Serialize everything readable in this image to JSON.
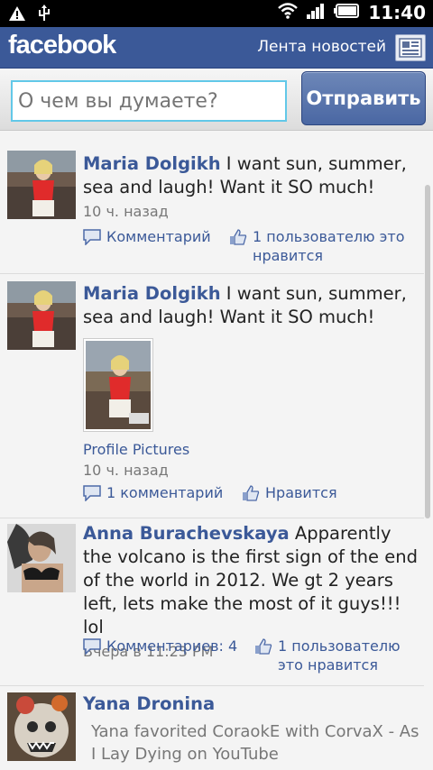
{
  "status_bar": {
    "time": "11:40"
  },
  "header": {
    "logo": "facebook",
    "feed_label": "Лента новостей"
  },
  "composer": {
    "placeholder": "О чем вы думаете?",
    "send_label": "Отправить"
  },
  "stories": [
    {
      "author": "Maria Dolgikh",
      "text": " I want sun, summer, sea and laugh! Want it SO  much!",
      "time": "10 ч. назад",
      "comment_label": "Комментарий",
      "like_label": "1 пользователю это нравится"
    },
    {
      "author": "Maria Dolgikh",
      "text": " I want sun, summer, sea and laugh! Want it SO much!",
      "album": "Profile Pictures",
      "time": "10 ч. назад",
      "comment_label": "1 комментарий",
      "like_label": "Нравится"
    },
    {
      "author": "Anna Burachevskaya",
      "text": " Apparently the volcano is the first sign of the end of the world in 2012. We gt 2 years left, lets make the most of it guys!!! lol",
      "time": "Вчера в 11:23 PM",
      "comment_label": "Комментариев: 4",
      "like_label": "1 пользователю это нравится"
    },
    {
      "author": "Yana Dronina",
      "activity": "Yana favorited CoraokE with CorvaX - As I Lay Dying on YouTube"
    }
  ],
  "colors": {
    "facebook_blue": "#3b5998",
    "input_focus": "#62c8e8"
  }
}
